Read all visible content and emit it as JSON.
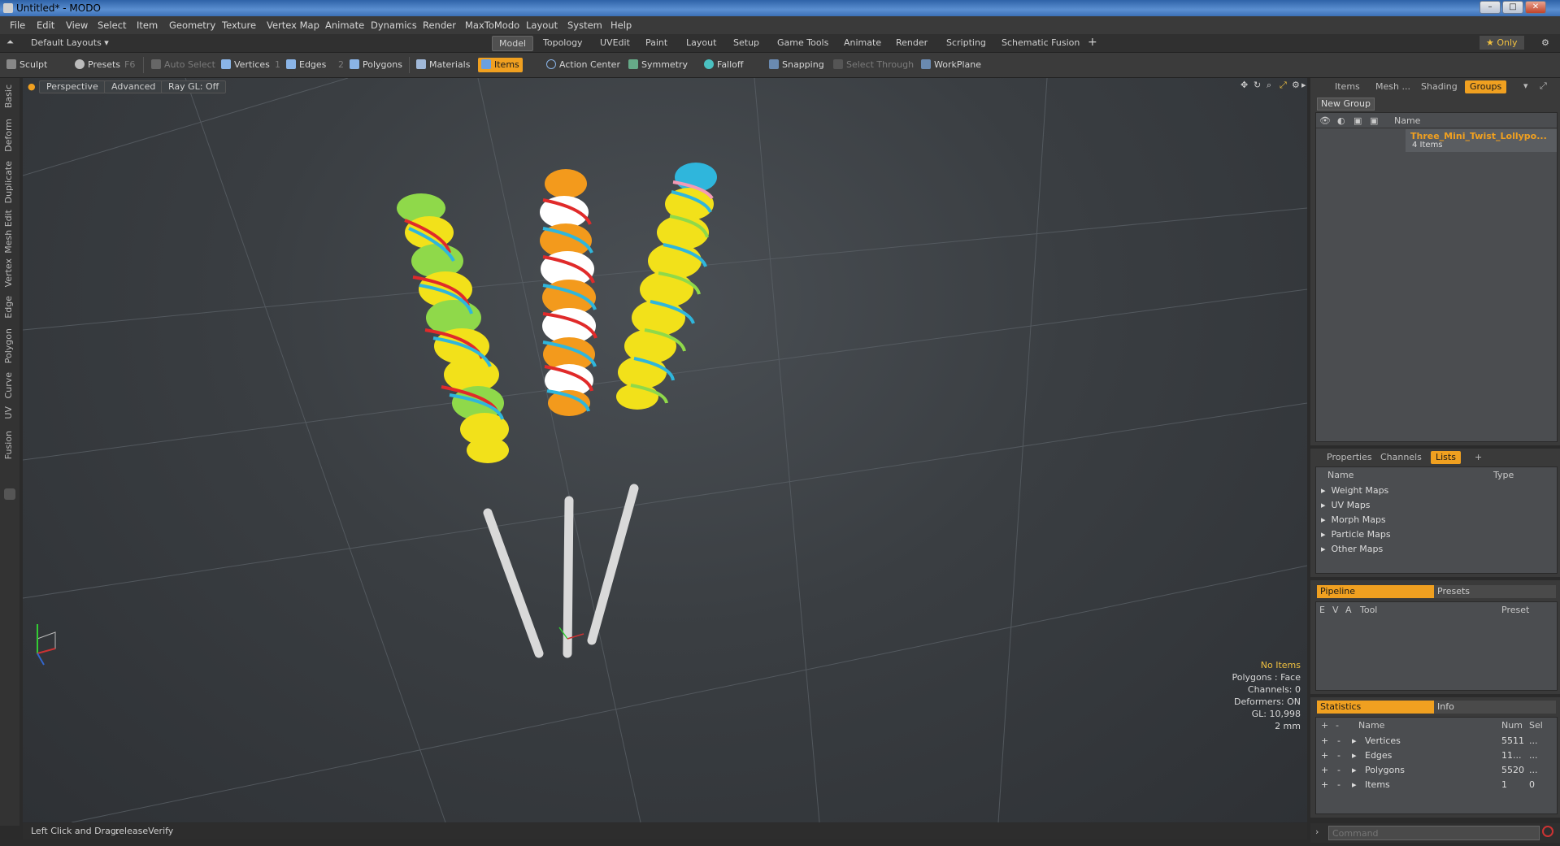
{
  "window": {
    "title": "Untitled* - MODO",
    "buttons": [
      "–",
      "□",
      "✕"
    ]
  },
  "menu": [
    "File",
    "Edit",
    "View",
    "Select",
    "Item",
    "Geometry",
    "Texture",
    "Vertex Map",
    "Animate",
    "Dynamics",
    "Render",
    "MaxToModo",
    "Layout",
    "System",
    "Help"
  ],
  "layout_bar": {
    "layout_dropdown": "Default Layouts ▾",
    "tabs": [
      "Model",
      "Topology",
      "UVEdit",
      "Paint",
      "Layout",
      "Setup",
      "Game Tools",
      "Animate",
      "Render",
      "Scripting",
      "Schematic Fusion"
    ],
    "active_tab": "Model",
    "add": "+",
    "only": "★  Only",
    "gear": "⚙"
  },
  "toolbar": {
    "sculpt": "Sculpt",
    "presets": "Presets",
    "presets_key": "F6",
    "auto_select": "Auto Select",
    "vertices": "Vertices",
    "vertices_key": "1",
    "edges": "Edges",
    "edges_key": "2",
    "polygons": "Polygons",
    "materials": "Materials",
    "items": "Items",
    "action_center": "Action Center",
    "symmetry": "Symmetry",
    "falloff": "Falloff",
    "snapping": "Snapping",
    "select_through": "Select Through",
    "workplane": "WorkPlane"
  },
  "left_tabs": [
    "Basic",
    "Deform",
    "Duplicate",
    "Mesh Edit",
    "Vertex",
    "Edge",
    "Polygon",
    "Curve",
    "UV",
    "Fusion"
  ],
  "viewport": {
    "view": "Perspective",
    "shading": "Advanced",
    "raygl": "Ray GL: Off",
    "stats": [
      "No Items",
      "Polygons : Face",
      "Channels: 0",
      "Deformers: ON",
      "GL: 10,998",
      "2 mm"
    ],
    "colors": {
      "stick": "#d9d9d9",
      "candy_yellow": "#f2e11a",
      "candy_green": "#8fd94a",
      "candy_red": "#e02a2a",
      "candy_blue": "#2fb6dc",
      "candy_orange": "#f39a1c"
    }
  },
  "statusbar": {
    "left": "Left Click and Drag:",
    "action": "releaseVerify"
  },
  "groups_panel": {
    "tabs": [
      "Items",
      "Mesh ...",
      "Shading",
      "Groups"
    ],
    "active_tab": "Groups",
    "new_group": "New Group",
    "column_name": "Name",
    "group_name": "Three_Mini_Twist_Lollypo...",
    "group_count": "4 Items"
  },
  "lists_panel": {
    "tabs": [
      "Properties",
      "Channels",
      "Lists"
    ],
    "active_tab": "Lists",
    "add": "+",
    "col_name": "Name",
    "col_type": "Type",
    "items": [
      "Weight Maps",
      "UV Maps",
      "Morph Maps",
      "Particle Maps",
      "Other Maps"
    ]
  },
  "pipeline_panel": {
    "tabs": [
      "Pipeline",
      "Presets"
    ],
    "cols": [
      "E",
      "V",
      "A",
      "Tool",
      "Preset"
    ]
  },
  "stats_panel": {
    "tabs": [
      "Statistics",
      "Info"
    ],
    "cols": [
      "+",
      "-",
      "Name",
      "Num",
      "Sel"
    ],
    "rows": [
      {
        "name": "Vertices",
        "num": "5511",
        "sel": "..."
      },
      {
        "name": "Edges",
        "num": "11...",
        "sel": "..."
      },
      {
        "name": "Polygons",
        "num": "5520",
        "sel": "..."
      },
      {
        "name": "Items",
        "num": "1",
        "sel": "0"
      }
    ]
  },
  "command": {
    "placeholder": "Command"
  }
}
